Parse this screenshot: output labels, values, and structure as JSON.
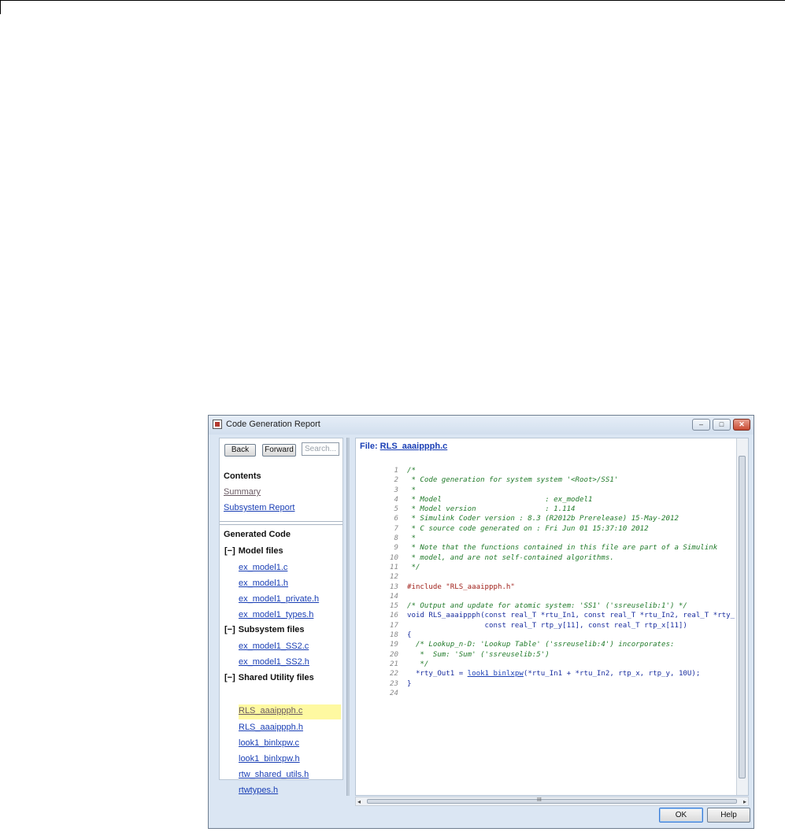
{
  "window": {
    "title": "Code Generation Report",
    "controls": {
      "minimize": "–",
      "maximize": "□",
      "close": "✕"
    }
  },
  "nav": {
    "back_label": "Back",
    "forward_label": "Forward",
    "search_placeholder": "Search...",
    "contents_heading": "Contents",
    "summary_link": "Summary",
    "subsystem_report_link": "Subsystem Report",
    "generated_code_heading": "Generated Code",
    "groups": [
      {
        "toggle": "[−]",
        "label": "Model files",
        "files": [
          "ex_model1.c",
          "ex_model1.h",
          "ex_model1_private.h",
          "ex_model1_types.h"
        ]
      },
      {
        "toggle": "[−]",
        "label": "Subsystem files",
        "files": [
          "ex_model1_SS2.c",
          "ex_model1_SS2.h"
        ]
      },
      {
        "toggle": "[−]",
        "label": "Shared Utility files",
        "files": [
          "RLS_aaaippph.c",
          "RLS_aaaippph.h",
          "look1_binlxpw.c",
          "look1_binlxpw.h",
          "rtw_shared_utils.h",
          "rtwtypes.h"
        ]
      }
    ],
    "selected_file": "RLS_aaaippph.c"
  },
  "code_view": {
    "file_label": "File: ",
    "file_name": "RLS_aaaippph.c",
    "lines": [
      {
        "n": "1",
        "text": "/*",
        "kind": "comment"
      },
      {
        "n": "2",
        "text": " * Code generation for system system '<Root>/SS1'",
        "kind": "comment"
      },
      {
        "n": "3",
        "text": " *",
        "kind": "comment"
      },
      {
        "n": "4",
        "text": " * Model                        : ex_model1",
        "kind": "comment"
      },
      {
        "n": "5",
        "text": " * Model version                : 1.114",
        "kind": "comment"
      },
      {
        "n": "6",
        "text": " * Simulink Coder version : 8.3 (R2012b Prerelease) 15-May-2012",
        "kind": "comment"
      },
      {
        "n": "7",
        "text": " * C source code generated on : Fri Jun 01 15:37:10 2012",
        "kind": "comment"
      },
      {
        "n": "8",
        "text": " *",
        "kind": "comment"
      },
      {
        "n": "9",
        "text": " * Note that the functions contained in this file are part of a Simulink",
        "kind": "comment"
      },
      {
        "n": "10",
        "text": " * model, and are not self-contained algorithms.",
        "kind": "comment"
      },
      {
        "n": "11",
        "text": " */",
        "kind": "comment"
      },
      {
        "n": "12",
        "text": "",
        "kind": "code"
      },
      {
        "n": "13",
        "text": "#include \"RLS_aaaippph.h\"",
        "kind": "pre"
      },
      {
        "n": "14",
        "text": "",
        "kind": "code"
      },
      {
        "n": "15",
        "text": "/* Output and update for atomic system: 'SS1' ('ssreuselib:1') */",
        "kind": "comment"
      },
      {
        "n": "16",
        "text": "void RLS_aaaippph(const real_T *rtu_In1, const real_T *rtu_In2, real_T *rty_",
        "kind": "code"
      },
      {
        "n": "17",
        "text": "                  const real_T rtp_y[11], const real_T rtp_x[11])",
        "kind": "code"
      },
      {
        "n": "18",
        "text": "{",
        "kind": "code"
      },
      {
        "n": "19",
        "text": "  /* Lookup_n-D: 'Lookup Table' ('ssreuselib:4') incorporates:",
        "kind": "comment"
      },
      {
        "n": "20",
        "text": "   *  Sum: 'Sum' ('ssreuselib:5')",
        "kind": "comment"
      },
      {
        "n": "21",
        "text": "   */",
        "kind": "comment"
      },
      {
        "n": "22",
        "text": "  *rty_Out1 = ",
        "kind": "code",
        "link": "look1_binlxpw",
        "after": "(*rtu_In1 + *rtu_In2, rtp_x, rtp_y, 10U);"
      },
      {
        "n": "23",
        "text": "}",
        "kind": "code"
      },
      {
        "n": "24",
        "text": "",
        "kind": "code"
      }
    ]
  },
  "scrollbar": {
    "h_mid_glyph": "III"
  },
  "buttons": {
    "ok_label": "OK",
    "help_label": "Help"
  }
}
